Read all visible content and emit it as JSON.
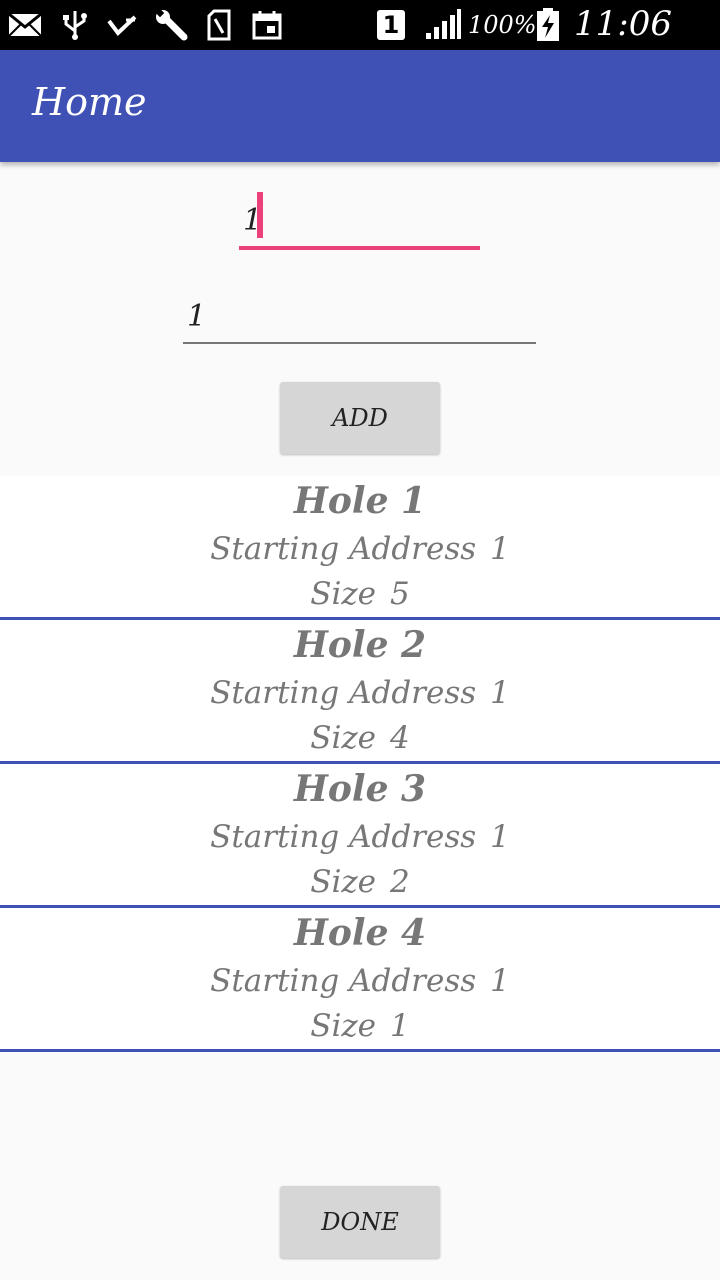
{
  "status_bar": {
    "icons": [
      "email-icon",
      "usb-icon",
      "check-icon",
      "wrench-icon",
      "sim-card-icon",
      "calendar-icon",
      "sim-slot-icon",
      "signal-icon",
      "battery-icon"
    ],
    "sim_label": "1",
    "battery_percent": "100%",
    "time": "11:06 PM"
  },
  "app_bar": {
    "title": "Home"
  },
  "form": {
    "field1_value": "1",
    "field2_value": "1",
    "add_label": "ADD",
    "accent_color": "#ec407a"
  },
  "holes": [
    {
      "title": "Hole 1",
      "address_label": "Starting Address",
      "address": "1",
      "size_label": "Size",
      "size": "5"
    },
    {
      "title": "Hole 2",
      "address_label": "Starting Address",
      "address": "1",
      "size_label": "Size",
      "size": "4"
    },
    {
      "title": "Hole 3",
      "address_label": "Starting Address",
      "address": "1",
      "size_label": "Size",
      "size": "2"
    },
    {
      "title": "Hole 4",
      "address_label": "Starting Address",
      "address": "1",
      "size_label": "Size",
      "size": "1"
    }
  ],
  "done_label": "DONE",
  "colors": {
    "primary": "#3f51b5",
    "accent": "#ec407a",
    "button": "#d6d6d6"
  }
}
